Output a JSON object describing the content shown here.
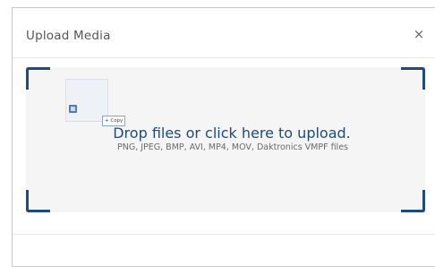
{
  "dialog": {
    "title": "Upload Media",
    "close_glyph": "×"
  },
  "dropzone": {
    "prompt": "Drop files or click here to upload.",
    "formats": "PNG, JPEG, BMP, AVI, MP4, MOV, Daktronics VMPF files"
  },
  "drag": {
    "copy_badge": "+ Copy"
  },
  "colors": {
    "accent": "#1e4b7c",
    "dropzone_bg": "#f5f5f5"
  }
}
